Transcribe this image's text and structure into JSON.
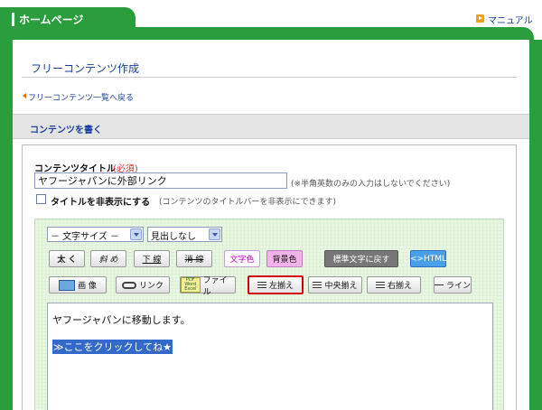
{
  "header": {
    "tab_title": "ホームページ",
    "manual_link": "マニュアル",
    "manual_icon": "play-icon"
  },
  "page": {
    "title": "フリーコンテンツ作成",
    "back_link": "フリーコンテンツ一覧へ戻る"
  },
  "section": {
    "title": "コンテンツを書く"
  },
  "form": {
    "title_label": "コンテンツタイトル",
    "required_label": "(必須)",
    "title_value": "ヤフージャパンに外部リンク",
    "title_hint": "(※半角英数のみの入力はしないでください)",
    "hide_checkbox_label": "タイトルを非表示にする",
    "hide_checkbox_checked": false,
    "hide_hint": "(コンテンツのタイトルバーを非表示にできます)"
  },
  "toolbar": {
    "font_size_select": "－ 文字サイズ －",
    "heading_select": "見出しなし",
    "bold": "太 く",
    "italic": "斜 め",
    "underline": "下 線",
    "strike": "消 線",
    "text_color": "文字色",
    "bg_color": "背景色",
    "reset": "標準文字に戻す",
    "html": "<>HTML",
    "image": "画 像",
    "link": "リンク",
    "file": "ファイル",
    "file_icon_text": "PDF Word Excel",
    "align_left": "左揃え",
    "align_center": "中央揃え",
    "align_right": "右揃え",
    "line": "ライン"
  },
  "editor": {
    "line1": "ヤフージャパンに移動します。",
    "line2": "≫ここをクリックしてね★"
  },
  "colors": {
    "brand_green": "#2a9d3c",
    "link_blue": "#1a3f9c",
    "selection_blue": "#3369c8",
    "active_outline": "#d00000"
  }
}
